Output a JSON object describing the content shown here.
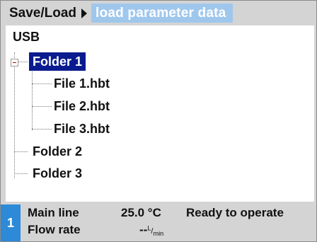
{
  "header": {
    "root_label": "Save/Load",
    "active_label": "load parameter data"
  },
  "tree": {
    "root": "USB",
    "folders": [
      {
        "label": "Folder 1",
        "expanded": true,
        "selected": true,
        "files": [
          "File 1.hbt",
          "File 2.hbt",
          "File 3.hbt"
        ]
      },
      {
        "label": "Folder 2"
      },
      {
        "label": "Folder 3"
      }
    ]
  },
  "status": {
    "index": "1",
    "line1_label": "Main line",
    "line1_value": "25.0 °C",
    "line2_label": "Flow rate",
    "line2_value": "--",
    "line2_unit_num": "L",
    "line2_unit_den": "min",
    "state_text": "Ready to operate"
  },
  "colors": {
    "highlight": "#0a1b8f",
    "header_active": "#9fc7ec",
    "status_index_bg": "#2c8ad8"
  }
}
